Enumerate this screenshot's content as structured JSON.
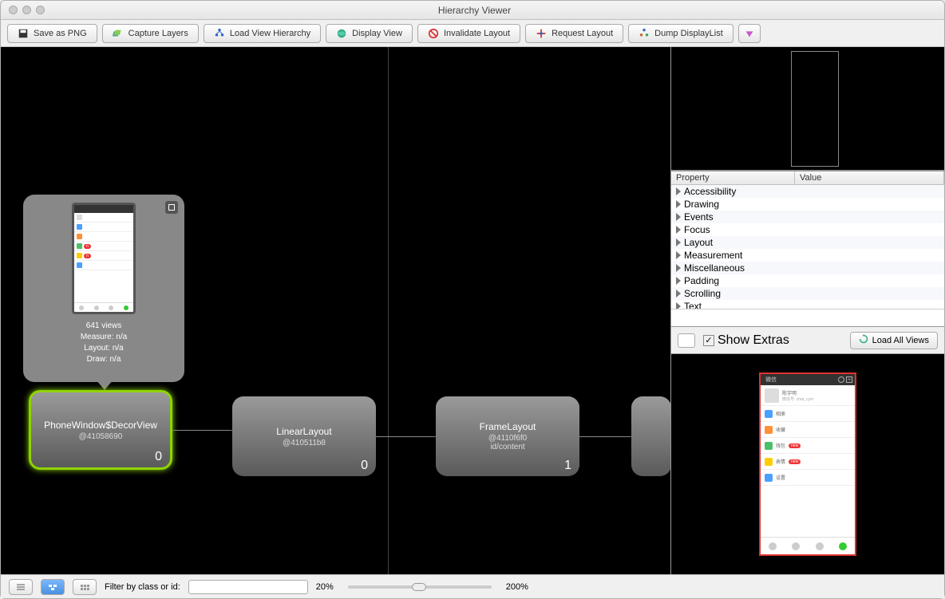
{
  "window": {
    "title": "Hierarchy Viewer"
  },
  "toolbar": {
    "save_png": "Save as PNG",
    "capture_layers": "Capture Layers",
    "load_hierarchy": "Load View Hierarchy",
    "display_view": "Display View",
    "invalidate_layout": "Invalidate Layout",
    "request_layout": "Request Layout",
    "dump_displaylist": "Dump DisplayList"
  },
  "nodes": {
    "decor": {
      "title": "PhoneWindow$DecorView",
      "id": "@41058690",
      "count": "0"
    },
    "linear": {
      "title": "LinearLayout",
      "id": "@410511b8",
      "count": "0"
    },
    "frame": {
      "title": "FrameLayout",
      "id": "@4110f6f0",
      "sub": "id/content",
      "count": "1"
    }
  },
  "tooltip": {
    "views": "641 views",
    "measure": "Measure: n/a",
    "layout": "Layout: n/a",
    "draw": "Draw: n/a"
  },
  "properties": {
    "header_property": "Property",
    "header_value": "Value",
    "groups": [
      "Accessibility",
      "Drawing",
      "Events",
      "Focus",
      "Layout",
      "Measurement",
      "Miscellaneous",
      "Padding",
      "Scrolling",
      "Text"
    ]
  },
  "controls": {
    "show_extras": "Show Extras",
    "load_all": "Load All Views"
  },
  "bottom": {
    "filter_label": "Filter by class or id:",
    "zoom_min": "20%",
    "zoom_max": "200%"
  },
  "preview": {
    "profile_name": "陈宇明",
    "profile_id": "微信号: chat_cym",
    "items": [
      {
        "label": "相册",
        "color": "#4aa0ff"
      },
      {
        "label": "收藏",
        "color": "#ff9038"
      },
      {
        "label": "钱包",
        "color": "#4ac06a",
        "badge": "new"
      },
      {
        "label": "表情",
        "color": "#ffcc00",
        "badge": "new"
      },
      {
        "label": "设置",
        "color": "#4aa0ff"
      }
    ]
  }
}
